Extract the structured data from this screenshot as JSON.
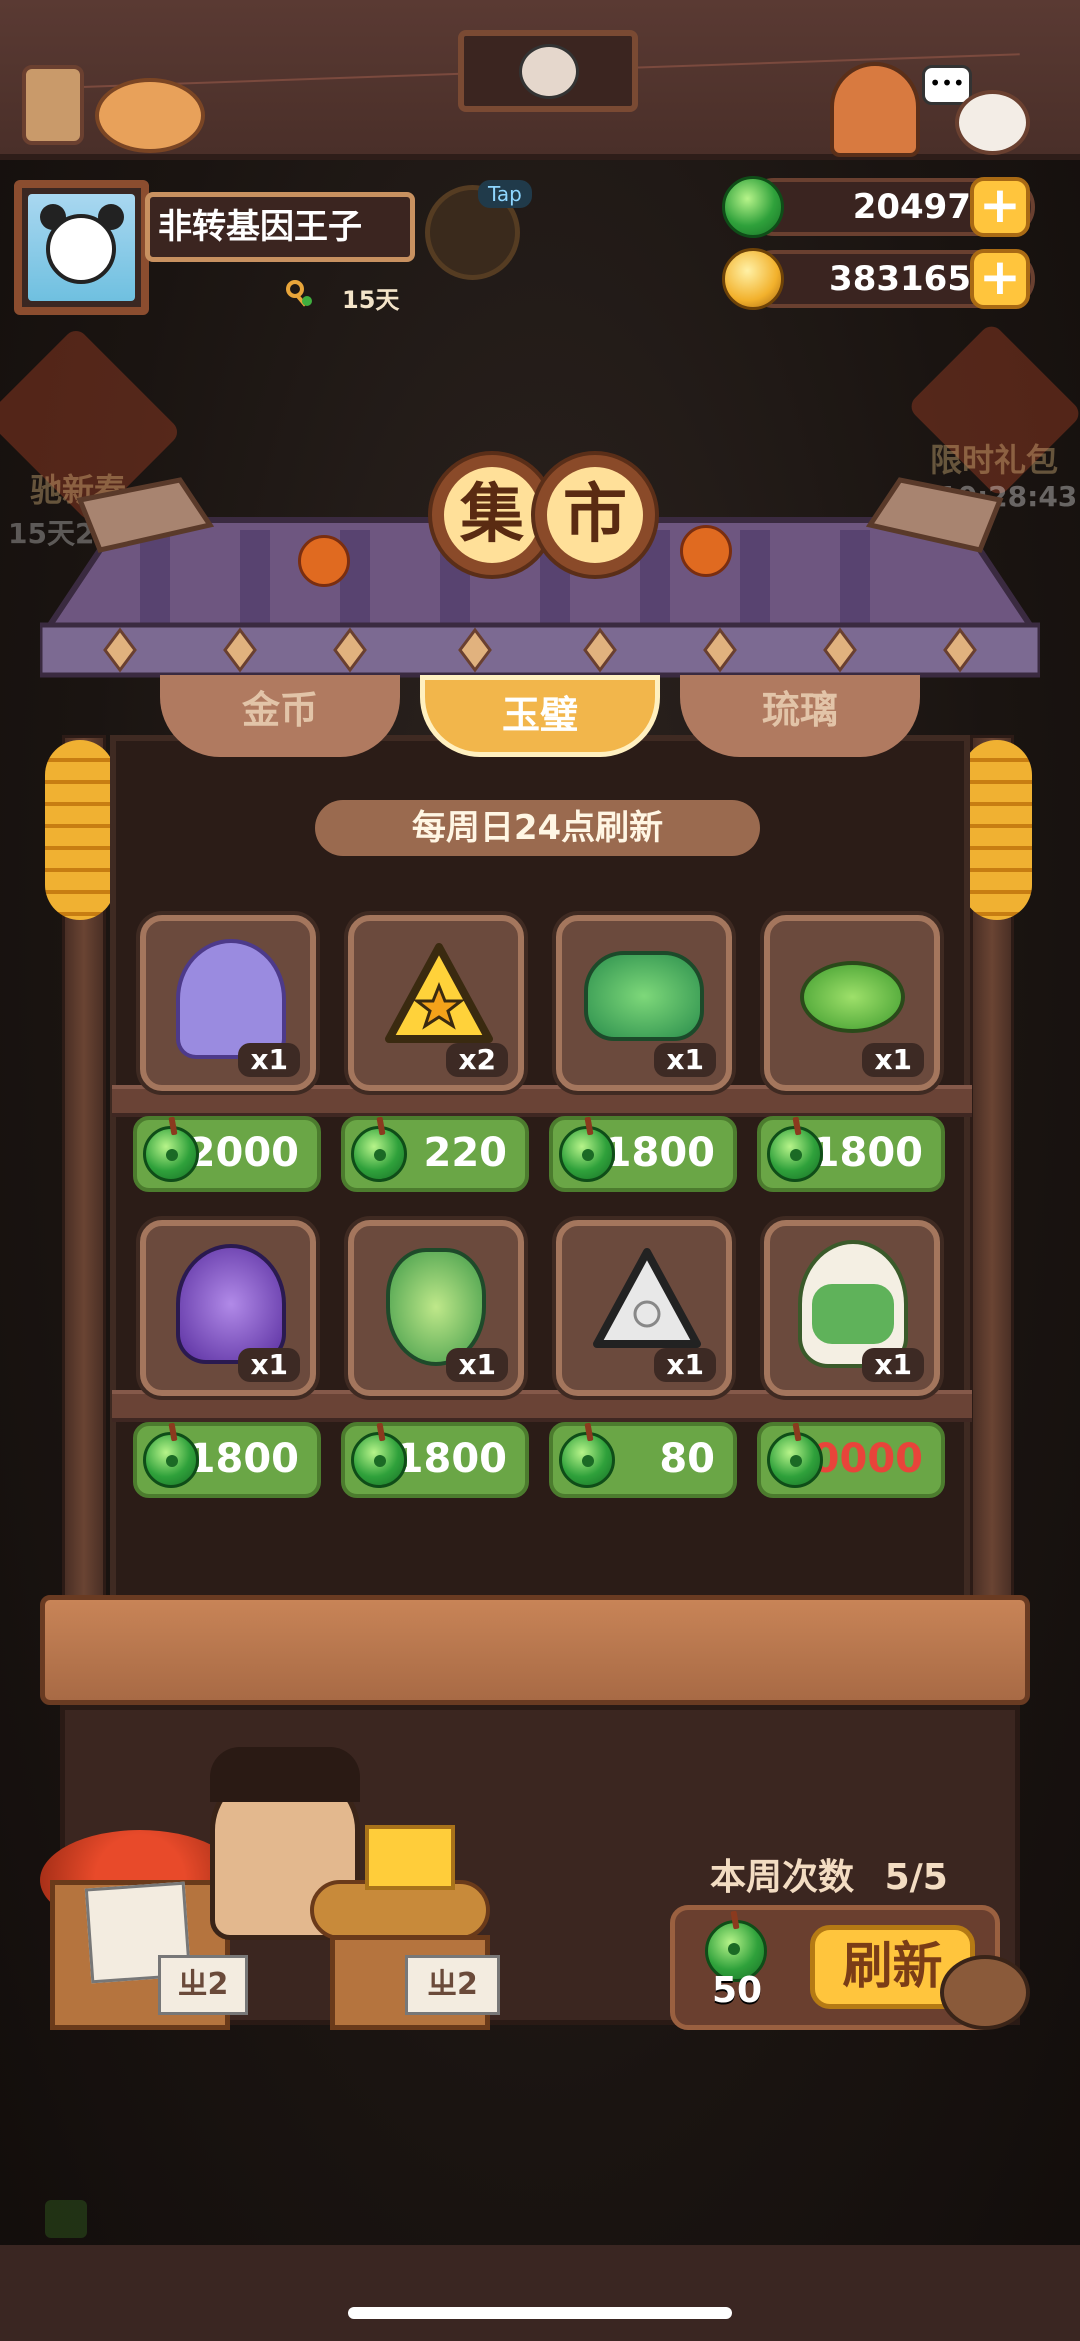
{
  "player": {
    "name": "非转基因王子",
    "days": "15天",
    "tap_badge": "Tap"
  },
  "currency": {
    "jade": "20497",
    "coins": "383165",
    "plus_label": "+"
  },
  "side": {
    "left_event_label": "驰新春",
    "left_event_timer": "15天22",
    "right_event_label": "限时礼包",
    "right_event_timer": "10:28:43"
  },
  "shop": {
    "title_char_1": "集",
    "title_char_2": "市",
    "tabs": [
      {
        "label": "金币"
      },
      {
        "label": "玉璧"
      },
      {
        "label": "琉璃"
      }
    ],
    "refresh_note": "每周日24点刷新",
    "items": [
      {
        "qty": "x1",
        "price": "2000",
        "icon": "character-purple-hair-icon"
      },
      {
        "qty": "x2",
        "price": "220",
        "icon": "star-triangle-icon"
      },
      {
        "qty": "x1",
        "price": "1800",
        "icon": "jade-pot-icon"
      },
      {
        "qty": "x1",
        "price": "1800",
        "icon": "green-jade-icon"
      },
      {
        "qty": "x1",
        "price": "1800",
        "icon": "purple-crystal-icon"
      },
      {
        "qty": "x1",
        "price": "1800",
        "icon": "jade-lock-icon"
      },
      {
        "qty": "x1",
        "price": "80",
        "icon": "silver-triangle-icon"
      },
      {
        "qty": "x1",
        "price": "30000",
        "icon": "character-green-hair-icon"
      }
    ],
    "weekly_count_label": "本周次数",
    "weekly_count_value": "5/5",
    "refresh_cost": "50",
    "refresh_label": "刷新",
    "colors": {
      "price_red": "#e8443a",
      "price_green": "#6aa646",
      "accent_gold": "#ffc53d"
    }
  },
  "stall": {
    "sign_left": "ㄓ2",
    "sign_right": "ㄓ2"
  }
}
